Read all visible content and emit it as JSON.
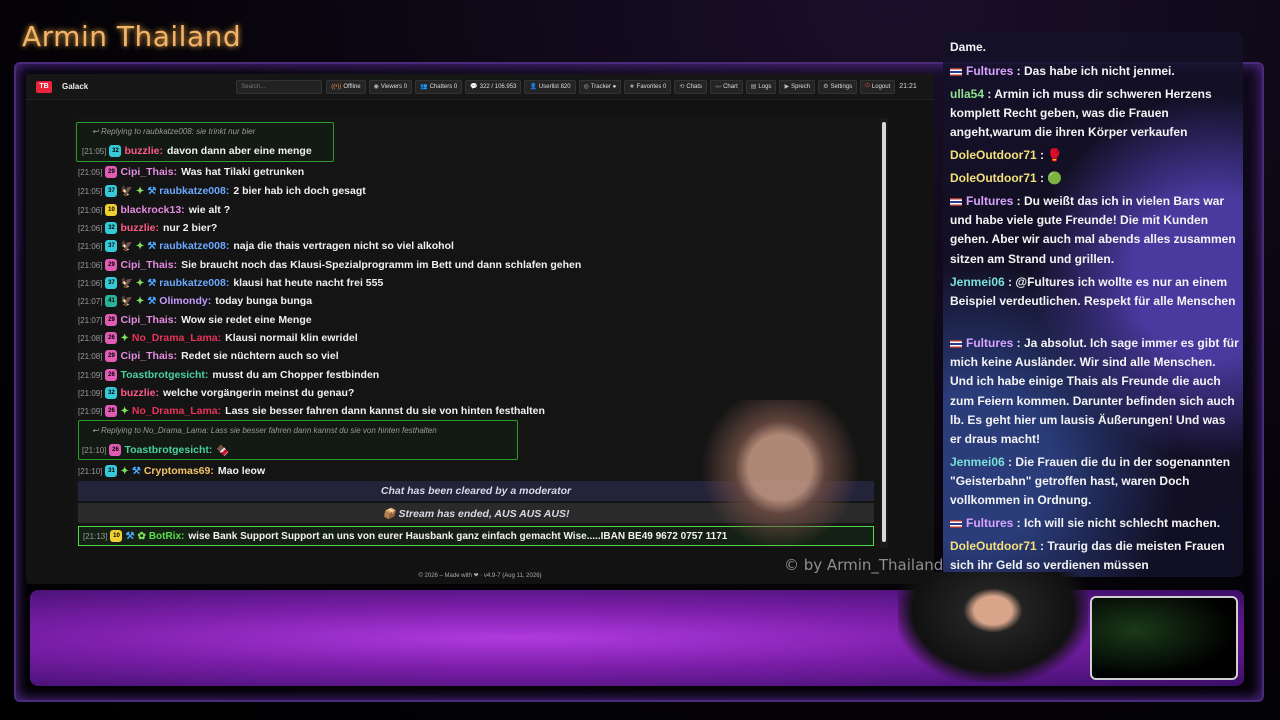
{
  "channel": {
    "title": "Armin Thailand",
    "watermark": "© by Armin_Thailand"
  },
  "app": {
    "logo": "TB",
    "name": "Galack",
    "search_placeholder": "Search...",
    "pills": [
      {
        "icon": "offline-icon",
        "glyph": "((•))",
        "label": "Offline"
      },
      {
        "icon": "eye-icon",
        "glyph": "◉",
        "label": "Viewers 0"
      },
      {
        "icon": "users-icon",
        "glyph": "👥",
        "label": "Chatters 0"
      },
      {
        "icon": "chat-icon",
        "glyph": "💬",
        "label": "322 / 106.953"
      },
      {
        "icon": "user-icon",
        "glyph": "👤",
        "label": "Userlist 820"
      },
      {
        "icon": "tracker-icon",
        "glyph": "◎",
        "label": "Tracker ●"
      },
      {
        "icon": "star-icon",
        "glyph": "★",
        "label": "Favorites 0"
      },
      {
        "icon": "history-icon",
        "glyph": "⟲",
        "label": "Chats"
      },
      {
        "icon": "chart-icon",
        "glyph": "〰",
        "label": "Chart"
      },
      {
        "icon": "logs-icon",
        "glyph": "▤",
        "label": "Logs"
      },
      {
        "icon": "speech-icon",
        "glyph": "▶",
        "label": "Sprech"
      },
      {
        "icon": "settings-icon",
        "glyph": "⚙",
        "label": "Settings"
      },
      {
        "icon": "logout-icon",
        "glyph": "⏻",
        "label": "Logout"
      }
    ],
    "clock": "21:21",
    "footer": "© 2026 – Made with ❤ · v4.9-7 (Aug 11, 2026)"
  },
  "chat": {
    "reply1": "Replying to raubkatze008: sie trinkt nur bier",
    "reply2": "Replying to No_Drama_Lama: Lass sie besser fahren dann kannst du sie von hinten festhalten",
    "messages": [
      {
        "ts": "[21:05]",
        "badge": "32",
        "bcolor": "b-cyan",
        "icons": [],
        "user": "buzzlie:",
        "ucolor": "#ff5a8a",
        "text": "davon dann aber eine menge"
      },
      {
        "ts": "[21:05]",
        "badge": "29",
        "bcolor": "b-pink",
        "icons": [],
        "user": "Cipi_Thais:",
        "ucolor": "#e58be0",
        "text": "Was hat Tilaki getrunken"
      },
      {
        "ts": "[21:05]",
        "badge": "37",
        "bcolor": "b-cyan",
        "icons": [
          "🦅",
          "✦",
          "⚒"
        ],
        "user": "raubkatze008:",
        "ucolor": "#6aa9ff",
        "text": "2 bier hab ich doch gesagt"
      },
      {
        "ts": "[21:06]",
        "badge": "10",
        "bcolor": "b-yellow",
        "icons": [],
        "user": "blackrock13:",
        "ucolor": "#e58be0",
        "text": "wie alt ?"
      },
      {
        "ts": "[21:06]",
        "badge": "32",
        "bcolor": "b-cyan",
        "icons": [],
        "user": "buzzlie:",
        "ucolor": "#ff5a8a",
        "text": "nur 2 bier?"
      },
      {
        "ts": "[21:06]",
        "badge": "37",
        "bcolor": "b-cyan",
        "icons": [
          "🦅",
          "✦",
          "⚒"
        ],
        "user": "raubkatze008:",
        "ucolor": "#6aa9ff",
        "text": "naja die thais vertragen nicht so viel alkohol"
      },
      {
        "ts": "[21:06]",
        "badge": "29",
        "bcolor": "b-pink",
        "icons": [],
        "user": "Cipi_Thais:",
        "ucolor": "#e58be0",
        "text": "Sie braucht noch das Klausi-Spezialprogramm im Bett und dann schlafen gehen"
      },
      {
        "ts": "[21:06]",
        "badge": "37",
        "bcolor": "b-cyan",
        "icons": [
          "🦅",
          "✦",
          "⚒"
        ],
        "user": "raubkatze008:",
        "ucolor": "#6aa9ff",
        "text": "klausi hat heute nacht frei 555"
      },
      {
        "ts": "[21:07]",
        "badge": "41",
        "bcolor": "b-teal",
        "icons": [
          "🦅",
          "✦",
          "⚒"
        ],
        "user": "Olimondy:",
        "ucolor": "#c59cff",
        "text": "today bunga bunga"
      },
      {
        "ts": "[21:07]",
        "badge": "29",
        "bcolor": "b-pink",
        "icons": [],
        "user": "Cipi_Thais:",
        "ucolor": "#e58be0",
        "text": "Wow sie redet eine Menge"
      },
      {
        "ts": "[21:08]",
        "badge": "26",
        "bcolor": "b-pink",
        "icons": [
          "✦"
        ],
        "user": "No_Drama_Lama:",
        "ucolor": "#e8335a",
        "text": "Klausi normail klin ewridel"
      },
      {
        "ts": "[21:08]",
        "badge": "29",
        "bcolor": "b-pink",
        "icons": [],
        "user": "Cipi_Thais:",
        "ucolor": "#e58be0",
        "text": "Redet sie nüchtern auch so viel"
      },
      {
        "ts": "[21:09]",
        "badge": "26",
        "bcolor": "b-pink",
        "icons": [],
        "user": "Toastbrotgesicht:",
        "ucolor": "#48d0a0",
        "text": "musst du am Chopper festbinden"
      },
      {
        "ts": "[21:09]",
        "badge": "32",
        "bcolor": "b-cyan",
        "icons": [],
        "user": "buzzlie:",
        "ucolor": "#ff5a8a",
        "text": "welche vorgängerin meinst du genau?"
      },
      {
        "ts": "[21:09]",
        "badge": "26",
        "bcolor": "b-pink",
        "icons": [
          "✦"
        ],
        "user": "No_Drama_Lama:",
        "ucolor": "#e8335a",
        "text": "Lass sie besser fahren dann kannst du sie von hinten festhalten"
      },
      {
        "ts": "[21:10]",
        "badge": "26",
        "bcolor": "b-pink",
        "icons": [],
        "user": "Toastbrotgesicht:",
        "ucolor": "#48d0a0",
        "text": "🍫"
      },
      {
        "ts": "[21:10]",
        "badge": "31",
        "bcolor": "b-cyan",
        "icons": [
          "✦",
          "⚒"
        ],
        "user": "Cryptomas69:",
        "ucolor": "#f3c36a",
        "text": "Mao leow"
      }
    ],
    "cleared": "Chat has been cleared by a moderator",
    "ended": "📦 Stream has ended, AUS AUS AUS!",
    "bot": {
      "ts": "[21:13]",
      "badge": "10",
      "user": "BotRix:",
      "text": "wise Bank Support Support an uns von eurer Hausbank ganz einfach gemacht Wise.....IBAN BE49 9672 0757 1171"
    }
  },
  "side_chat": [
    {
      "flag": false,
      "user": "",
      "ucolor": "",
      "text": "Dame."
    },
    {
      "flag": true,
      "user": "Fultures",
      "ucolor": "ss",
      "text": " : Das habe ich nicht jenmei."
    },
    {
      "flag": false,
      "user": "ulla54",
      "ucolor": "sn-green",
      "text": " : Armin ich muss dir schweren Herzens komplett Recht geben, was die Frauen angeht,warum die ihren Körper verkaufen"
    },
    {
      "flag": false,
      "user": "DoleOutdoor71",
      "ucolor": "sn-yellow",
      "text": " : 🥊"
    },
    {
      "flag": false,
      "user": "DoleOutdoor71",
      "ucolor": "sn-yellow",
      "text": " : 🟢"
    },
    {
      "flag": true,
      "user": "Fultures",
      "ucolor": "ss",
      "text": " : Du weißt das ich in vielen Bars war und habe viele gute Freunde! Die mit Kunden gehen. Aber wir auch mal abends alles zusammen sitzen am Strand und grillen."
    },
    {
      "flag": false,
      "user": "Jenmei06",
      "ucolor": "sn-cyan",
      "text": " : @Fultures ich wollte es nur an einem Beispiel verdeutlichen. Respekt für alle Menschen"
    },
    {
      "flag": true,
      "user": "Fultures",
      "ucolor": "ss",
      "text": " : Ja absolut. Ich sage immer es gibt für mich keine Ausländer. Wir sind alle Menschen. Und ich habe einige Thais als Freunde die auch zum Feiern kommen. Darunter befinden sich auch lb. Es geht hier um lausis Äußerungen! Und was er draus macht!"
    },
    {
      "flag": false,
      "user": "Jenmei06",
      "ucolor": "sn-cyan",
      "text": " : Die Frauen die du in der sogenannten \"Geisterbahn\" getroffen hast, waren Doch vollkommen in Ordnung."
    },
    {
      "flag": true,
      "user": "Fultures",
      "ucolor": "ss",
      "text": " : Ich will sie nicht schlecht machen."
    },
    {
      "flag": false,
      "user": "DoleOutdoor71",
      "ucolor": "sn-yellow",
      "text": " : Traurig das die meisten Frauen sich ihr Geld so verdienen müssen"
    }
  ]
}
